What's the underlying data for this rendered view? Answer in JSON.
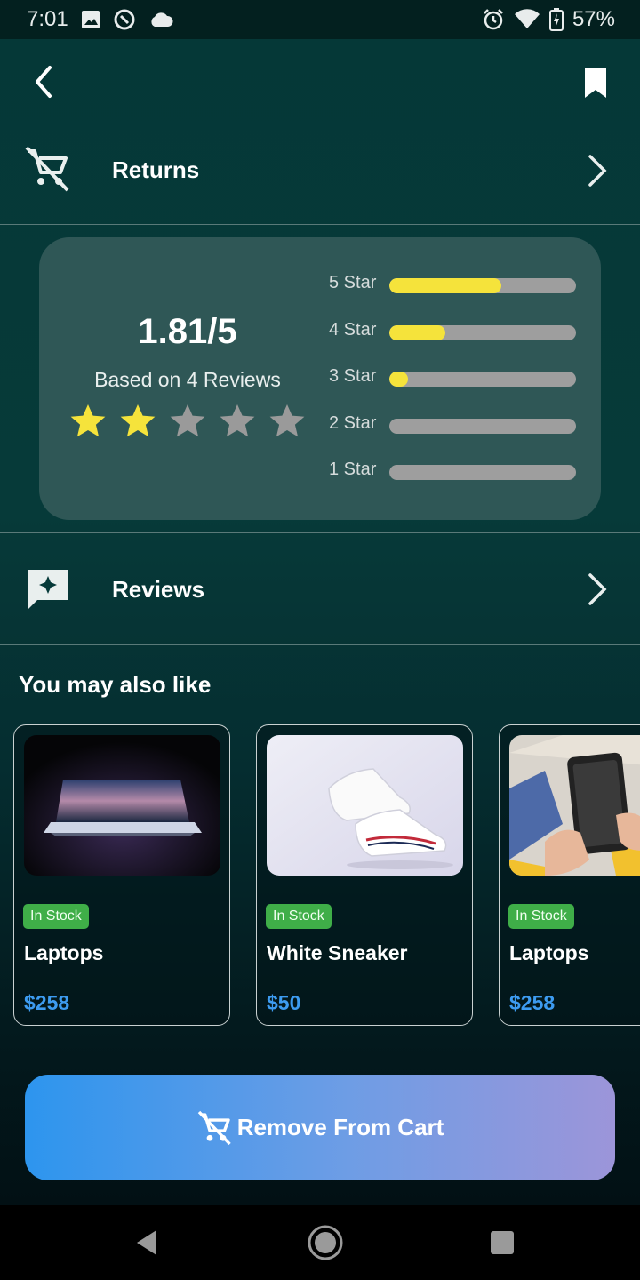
{
  "status_bar": {
    "time": "7:01",
    "battery": "57%",
    "icons": [
      "image-icon",
      "data-saver-icon",
      "cloud-icon",
      "alarm-icon",
      "wifi-icon",
      "battery-charging-icon"
    ]
  },
  "header": {
    "back_icon": "back-arrow-icon",
    "bookmark_icon": "bookmark-icon"
  },
  "returns_row": {
    "label": "Returns",
    "icon": "remove-cart-icon"
  },
  "rating": {
    "score": "1.81/5",
    "based_on": "Based on 4 Reviews",
    "stars_filled": 2,
    "stars_total": 5,
    "star_color": "#f5e33b",
    "breakdown": [
      {
        "label": "5 Star",
        "fraction": 0.6
      },
      {
        "label": "4 Star",
        "fraction": 0.3
      },
      {
        "label": "3 Star",
        "fraction": 0.1
      },
      {
        "label": "2 Star",
        "fraction": 0
      },
      {
        "label": "1 Star",
        "fraction": 0
      }
    ]
  },
  "reviews_row": {
    "label": "Reviews",
    "icon": "review-sparkle-icon"
  },
  "recommendations": {
    "title": "You may also like",
    "items": [
      {
        "badge": "In Stock",
        "name": "Laptops",
        "price": "$258",
        "image": "laptop-photo"
      },
      {
        "badge": "In Stock",
        "name": "White Sneaker",
        "price": "$50",
        "image": "sneaker-photo"
      },
      {
        "badge": "In Stock",
        "name": "Laptops",
        "price": "$258",
        "image": "phone-in-hand-photo"
      }
    ]
  },
  "action": {
    "label": "Remove From Cart",
    "icon": "remove-cart-icon"
  },
  "nav": {
    "icons": [
      "back-triangle-icon",
      "home-circle-icon",
      "recents-square-icon"
    ]
  },
  "colors": {
    "accent_price": "#3d9bf0",
    "stock_badge": "#3fae48",
    "bar_fill": "#f5e33b",
    "card_bg": "#2f5756"
  }
}
